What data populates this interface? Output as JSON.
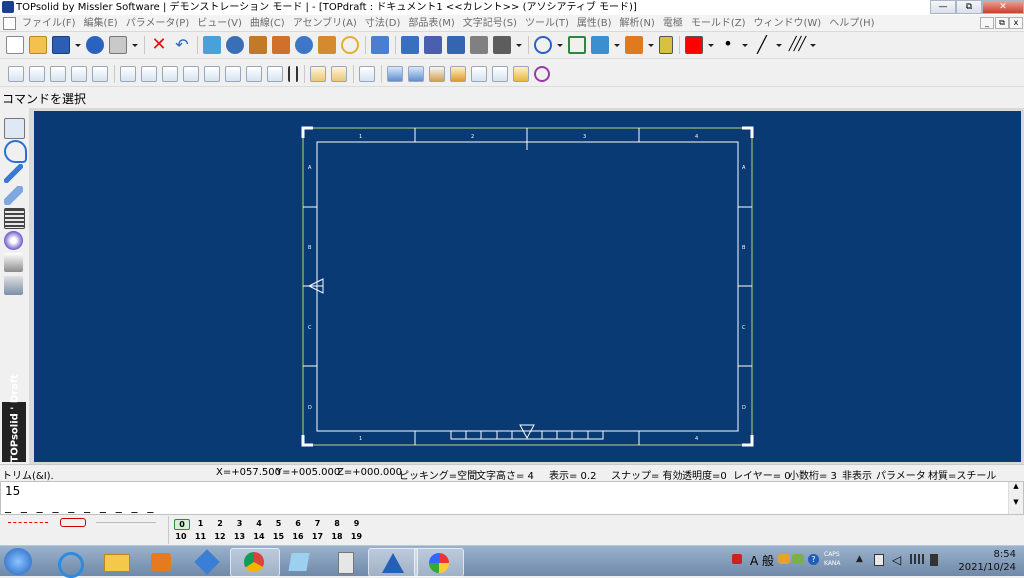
{
  "window": {
    "title": "TOPsolid by Missler Software | デモンストレーション モード | - [TOPdraft : ドキュメント1  <<カレント>> (アソシアティブ モード)]",
    "min_label": "—",
    "max_label": "⧉",
    "close_label": "✕"
  },
  "menu": {
    "items": [
      "ファイル(F)",
      "編集(E)",
      "パラメータ(P)",
      "ビュー(V)",
      "曲線(C)",
      "アセンブリ(A)",
      "寸法(D)",
      "部品表(M)",
      "文字記号(S)",
      "ツール(T)",
      "属性(B)",
      "解析(N)",
      "電極",
      "モールド(Z)",
      "ウィンドウ(W)",
      "ヘルプ(H)"
    ],
    "mdi_min": "_",
    "mdi_restore": "⧉",
    "mdi_close": "x"
  },
  "colors": {
    "canvas": "#0a3a74",
    "frame_outer": "#b9d77b",
    "frame_inner": "#ffffff",
    "current_color": "#ff0000"
  },
  "prompt": {
    "text": "コマンドを選択"
  },
  "brand": {
    "text": "TOPsolid ' Draft"
  },
  "drawing": {
    "top_zone_labels": [
      "1",
      "2",
      "3",
      "4"
    ],
    "bottom_zone_labels": [
      "1",
      "4"
    ],
    "side_zone_labels": [
      "A",
      "B",
      "C",
      "D"
    ]
  },
  "status": {
    "mode": "トリム(&I).",
    "x": "X=+057.500",
    "y": "Y=+005.000",
    "z": "Z=+000.000",
    "picking": "ピッキング=空間",
    "text_height": "文字高さ=  4",
    "display": "表示=   0.2",
    "snap": "スナップ= 有効",
    "transparency": "透明度=0",
    "layer": "レイヤー=  0",
    "decimals": "小数桁= 3",
    "hidden": "非表示",
    "param": "パラメータ",
    "material": "材質=スチール"
  },
  "command": {
    "value": "15",
    "dashes": "_ _ _ _ _ _ _ _ _ _"
  },
  "layers": {
    "row1": [
      "0",
      "1",
      "2",
      "3",
      "4",
      "5",
      "6",
      "7",
      "8",
      "9"
    ],
    "row2": [
      "10",
      "11",
      "12",
      "13",
      "14",
      "15",
      "16",
      "17",
      "18",
      "19"
    ]
  },
  "taskbar": {
    "ime": "A 般",
    "caps": "CAPS",
    "kana": "KANA",
    "time": "8:54",
    "date": "2021/10/24"
  }
}
